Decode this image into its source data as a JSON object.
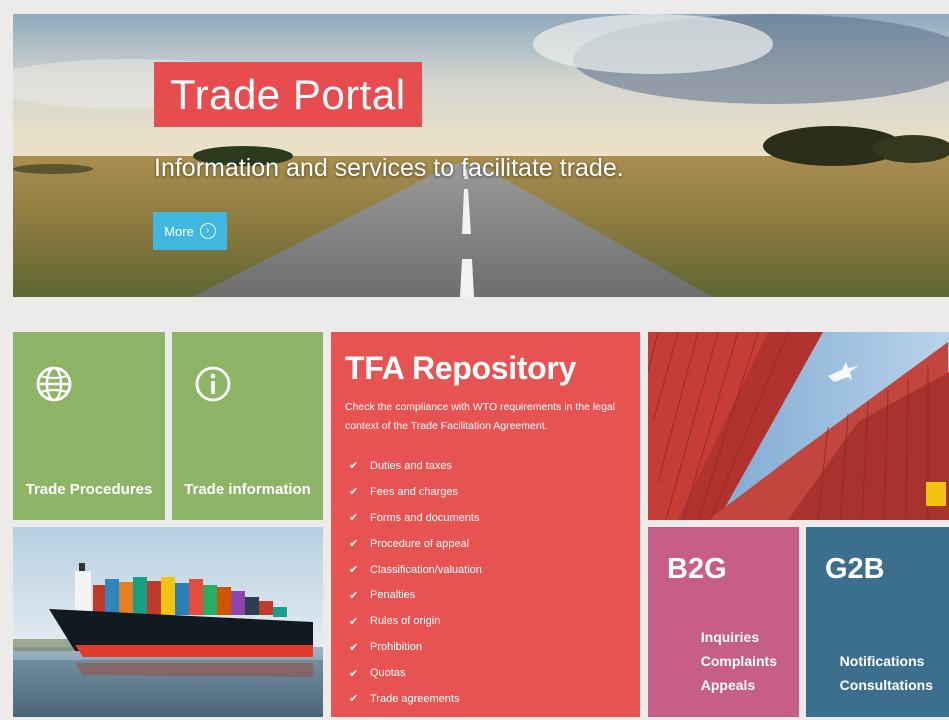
{
  "hero": {
    "title": "Trade Portal",
    "subtitle": "Information and services to facilitate trade.",
    "more_label": "More",
    "more_icon": "chevron-right-circle-icon"
  },
  "tiles": {
    "trade_procedures": {
      "label": "Trade Procedures",
      "icon": "globe-icon"
    },
    "trade_information": {
      "label": "Trade information",
      "icon": "info-circle-icon"
    }
  },
  "tfa": {
    "title": "TFA Repository",
    "description": "Check the compliance with WTO requirements in the legal context of the Trade Facilitation Agreement.",
    "items": [
      "Duties and taxes",
      "Fees and charges",
      "Forms and documents",
      "Procedure of appeal",
      "Classification/valuation",
      "Penalties",
      "Rules of origin",
      "Prohibition",
      "Quotas",
      "Trade agreements"
    ]
  },
  "b2g": {
    "title": "B2G",
    "lines": [
      "Inquiries",
      "Complaints",
      "Appeals"
    ]
  },
  "g2b": {
    "title": "G2B",
    "lines": [
      "Notifications",
      "Consultations"
    ]
  },
  "colors": {
    "red": "#e75352",
    "green": "#8db467",
    "pink": "#c65e86",
    "navy": "#3c6f8d",
    "button_blue": "#3fb7df"
  }
}
